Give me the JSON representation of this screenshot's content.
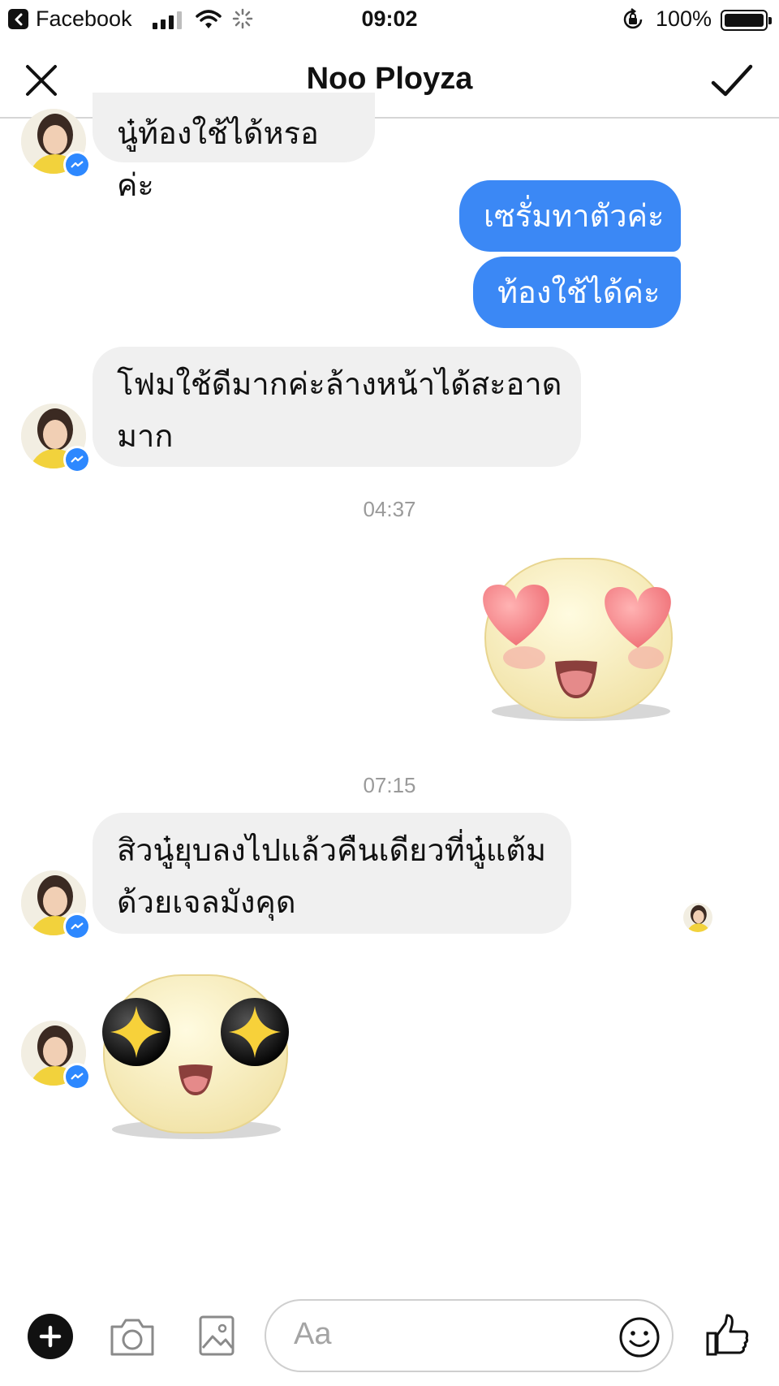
{
  "status_bar": {
    "app_name": "Facebook",
    "time": "09:02",
    "battery": "100%"
  },
  "header": {
    "title": "Noo Ployza"
  },
  "messages": {
    "m1": "นู๋ท้องใช้ได้หรอค่ะ",
    "m2": "เซรั่มทาตัวค่ะ",
    "m3": "ท้องใช้ได้ค่ะ",
    "m4_line1": "โฟมใช้ดีมากค่ะล้างหน้าได้สะอาด",
    "m4_line2": "มาก",
    "time1": "04:37",
    "time2": "07:15",
    "m5_line1": "สิวนู๋ยุบลงไปแล้วคืนเดียวที่นู๋แต้ม",
    "m5_line2": "ด้วยเจลมังคุด"
  },
  "composer": {
    "placeholder": "Aa"
  },
  "colors": {
    "accent": "#3b88f5",
    "incoming_bubble": "#f0f0f0",
    "messenger_badge": "#2d88ff"
  },
  "icons": [
    "back-arrow-icon",
    "cellular-signal-icon",
    "wifi-icon",
    "activity-spinner-icon",
    "rotation-lock-icon",
    "battery-icon",
    "close-icon",
    "checkmark-icon",
    "messenger-badge-icon",
    "heart-eyes-sticker",
    "sparkle-eyes-sticker",
    "plus-icon",
    "camera-icon",
    "gallery-icon",
    "emoji-icon",
    "thumbs-up-icon"
  ]
}
